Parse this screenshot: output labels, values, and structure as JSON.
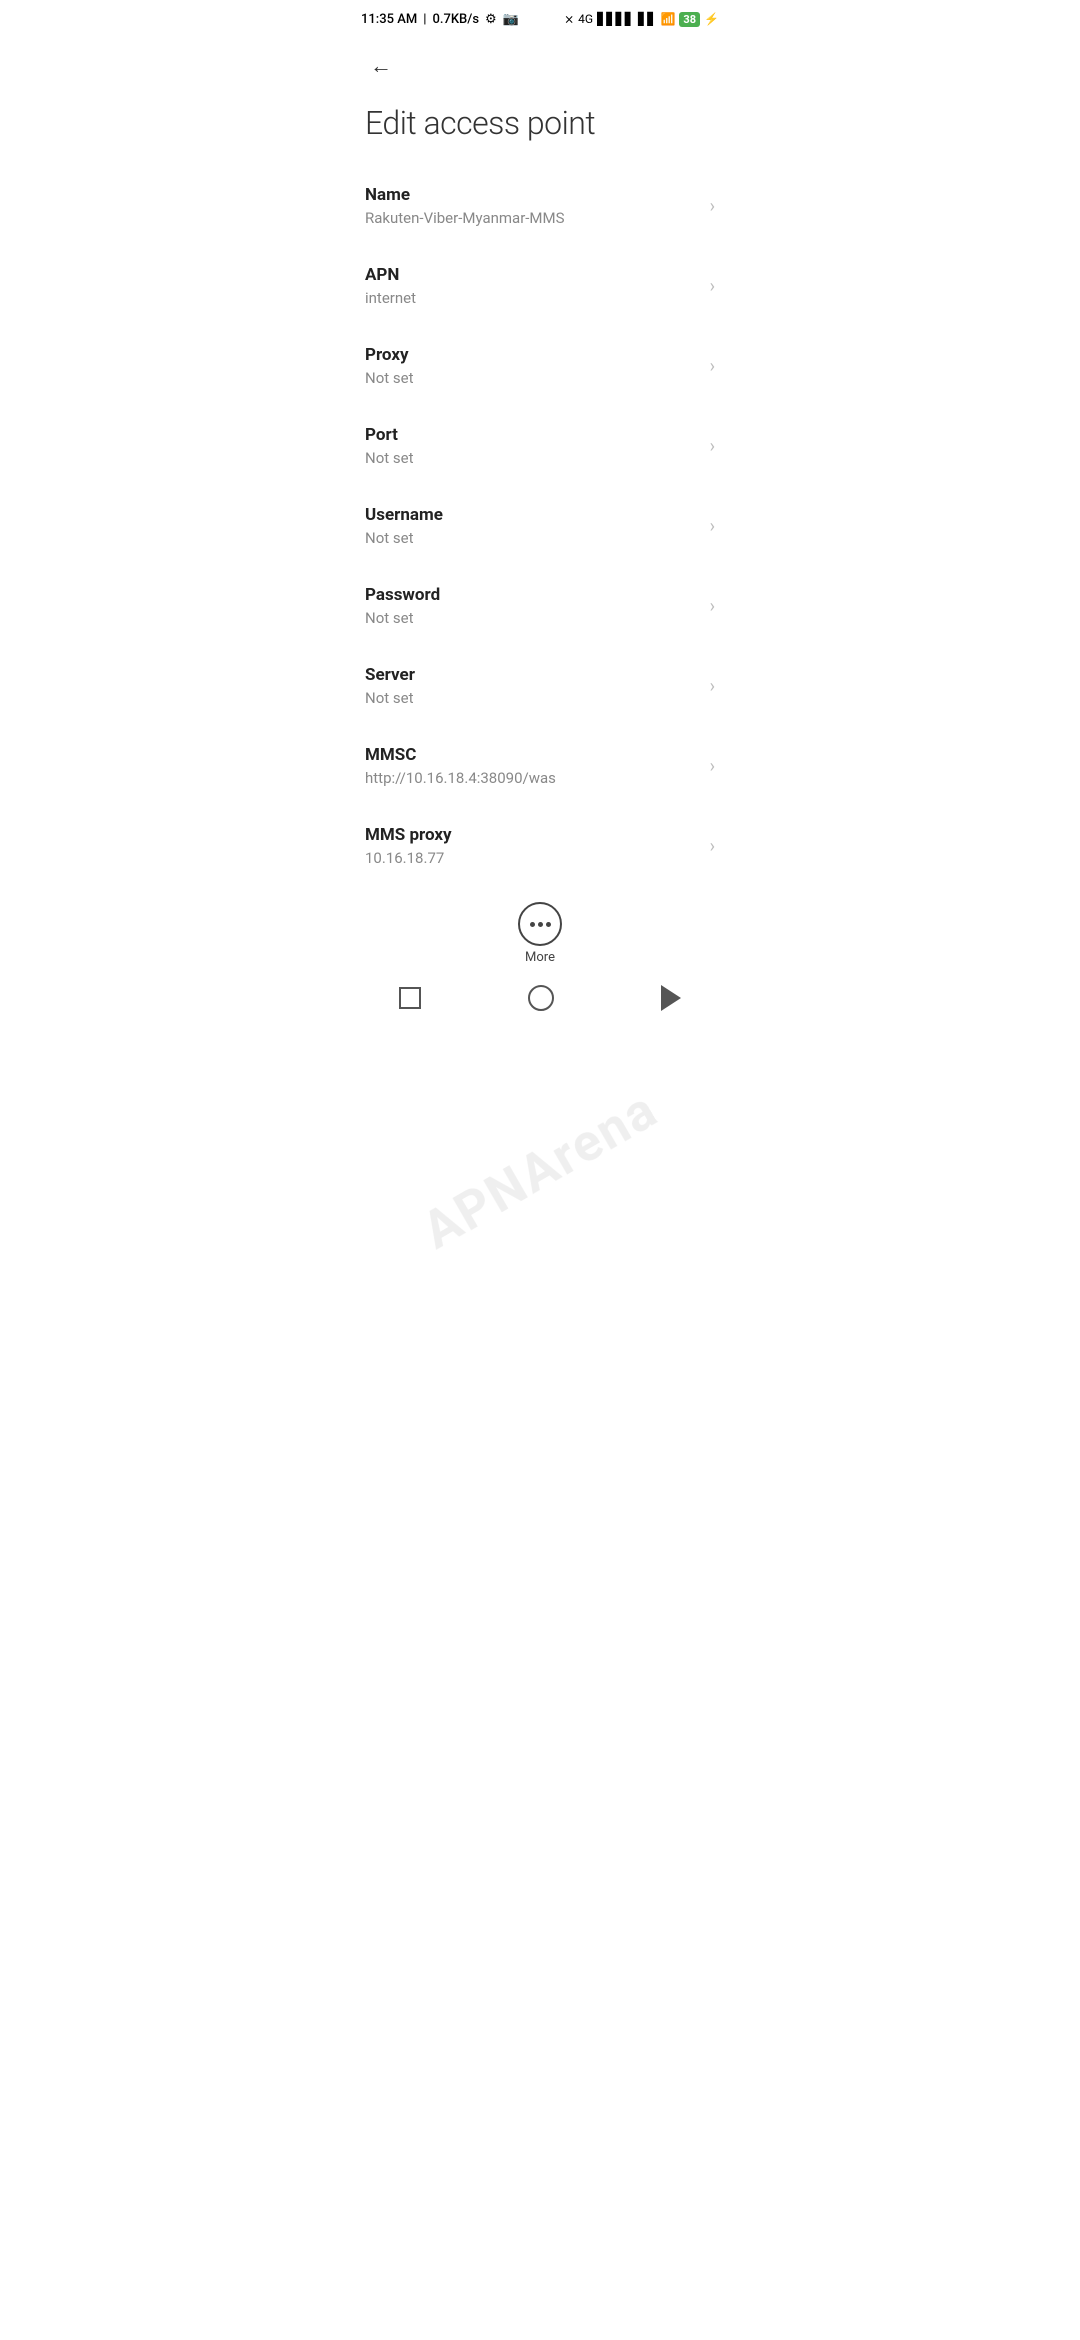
{
  "statusBar": {
    "time": "11:35 AM",
    "networkSpeed": "0.7KB/s"
  },
  "page": {
    "title": "Edit access point"
  },
  "settings": [
    {
      "id": "name",
      "label": "Name",
      "value": "Rakuten-Viber-Myanmar-MMS"
    },
    {
      "id": "apn",
      "label": "APN",
      "value": "internet"
    },
    {
      "id": "proxy",
      "label": "Proxy",
      "value": "Not set"
    },
    {
      "id": "port",
      "label": "Port",
      "value": "Not set"
    },
    {
      "id": "username",
      "label": "Username",
      "value": "Not set"
    },
    {
      "id": "password",
      "label": "Password",
      "value": "Not set"
    },
    {
      "id": "server",
      "label": "Server",
      "value": "Not set"
    },
    {
      "id": "mmsc",
      "label": "MMSC",
      "value": "http://10.16.18.4:38090/was"
    },
    {
      "id": "mms-proxy",
      "label": "MMS proxy",
      "value": "10.16.18.77"
    }
  ],
  "bottomBar": {
    "moreLabel": "More"
  },
  "watermark": "APNArena"
}
